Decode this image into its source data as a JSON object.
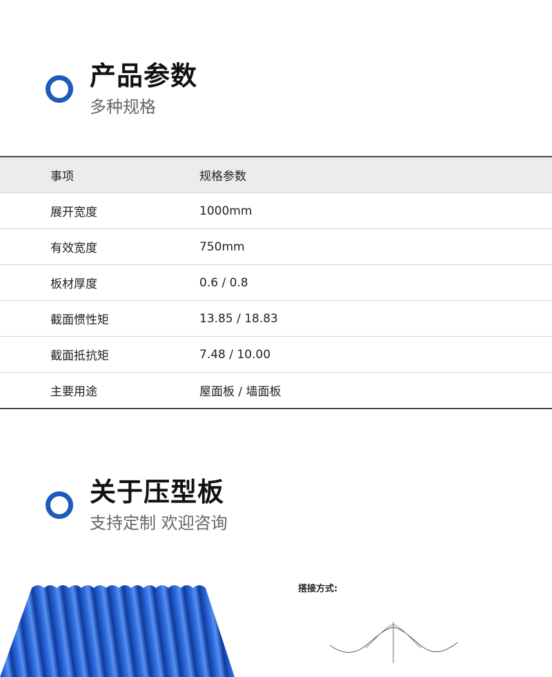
{
  "section1": {
    "title": "产品参数",
    "subtitle": "多种规格"
  },
  "table": {
    "header": [
      "事项",
      "规格参数"
    ],
    "rows": [
      [
        "展开宽度",
        "1000mm"
      ],
      [
        "有效宽度",
        "750mm"
      ],
      [
        "板材厚度",
        "0.6 / 0.8"
      ],
      [
        "截面惯性矩",
        "13.85 / 18.83"
      ],
      [
        "截面抵抗矩",
        "7.48 / 10.00"
      ],
      [
        "主要用途",
        "屋面板 / 墙面板"
      ]
    ]
  },
  "section2": {
    "title": "关于压型板",
    "subtitle": "支持定制 欢迎咨询"
  },
  "overlap": {
    "label": "搭接方式:"
  },
  "colors": {
    "accent": "#1e5bb8",
    "sheet": "#2a5fd0"
  }
}
